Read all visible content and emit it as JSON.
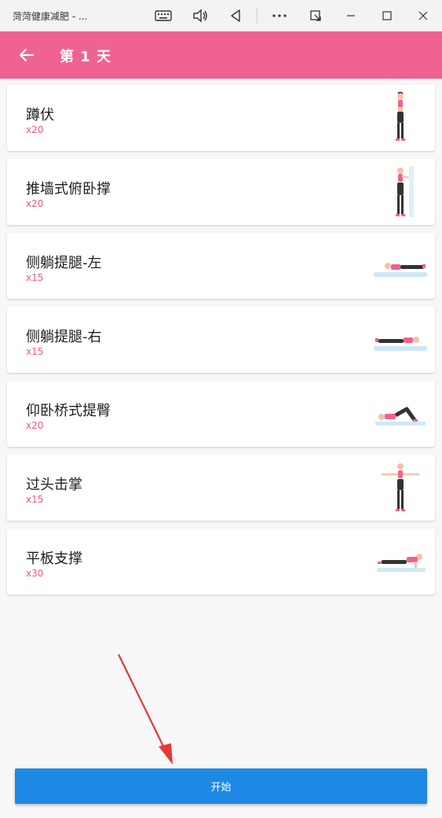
{
  "window": {
    "title": "菏菏健康减肥 - ..."
  },
  "appbar": {
    "title": "第 1 天"
  },
  "exercises": [
    {
      "name": "蹲伏",
      "reps": "x20"
    },
    {
      "name": "推墙式俯卧撑",
      "reps": "x20"
    },
    {
      "name": "侧躺提腿-左",
      "reps": "x15"
    },
    {
      "name": "侧躺提腿-右",
      "reps": "x15"
    },
    {
      "name": "仰卧桥式提臀",
      "reps": "x20"
    },
    {
      "name": "过头击掌",
      "reps": "x15"
    },
    {
      "name": "平板支撑",
      "reps": "x30"
    }
  ],
  "start_button": {
    "label": "开始"
  },
  "colors": {
    "appbar": "#f06292",
    "reps": "#e85a8a",
    "start_button": "#1e88e5",
    "annotation_arrow": "#e53935"
  }
}
